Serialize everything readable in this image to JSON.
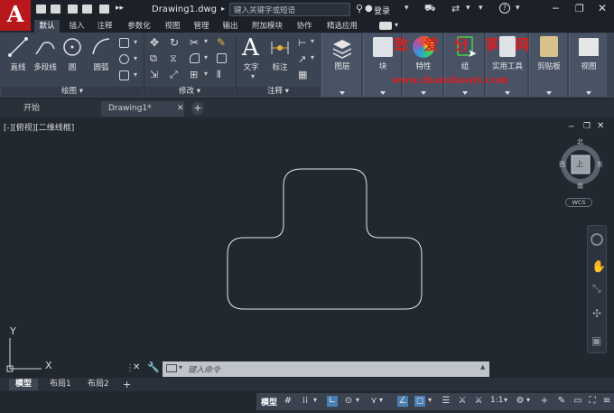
{
  "title_bar": {
    "doc_title": "Drawing1.dwg",
    "search_placeholder": "键入关键字或短语",
    "login": "登录",
    "app_logo": "A"
  },
  "ribbon_tabs": [
    "默认",
    "插入",
    "注释",
    "参数化",
    "视图",
    "管理",
    "输出",
    "附加模块",
    "协作",
    "精选应用"
  ],
  "ribbon": {
    "draw_tools": [
      "直线",
      "多段线",
      "圆",
      "圆弧"
    ],
    "draw_panel": "绘图",
    "modify_panel": "修改",
    "annotation_tools": [
      "文字",
      "标注"
    ],
    "annotation_panel": "注释",
    "big_tools": [
      "图层",
      "块",
      "特性",
      "组",
      "实用工具",
      "剪贴板",
      "视图"
    ]
  },
  "watermark": {
    "text": "致 爱 分 享 网",
    "url": "www.zhanshaoyi.com"
  },
  "doc_tabs": [
    "开始",
    "Drawing1*"
  ],
  "viewport_label": "[-][俯视][二维线框]",
  "viewcube": {
    "north": "北",
    "south": "南",
    "east": "东",
    "west": "西",
    "top": "上",
    "wcs": "WCS"
  },
  "ucs": {
    "x": "X",
    "y": "Y"
  },
  "command_line": {
    "placeholder": "键入命令"
  },
  "layout_tabs": [
    "模型",
    "布局1",
    "布局2"
  ],
  "status_bar": {
    "model": "模型",
    "scale": "1:1"
  },
  "colors": {
    "canvas": "#212830",
    "ribbon": "#3b4453",
    "accent": "#4a7fb5",
    "logo": "#b8171c"
  }
}
